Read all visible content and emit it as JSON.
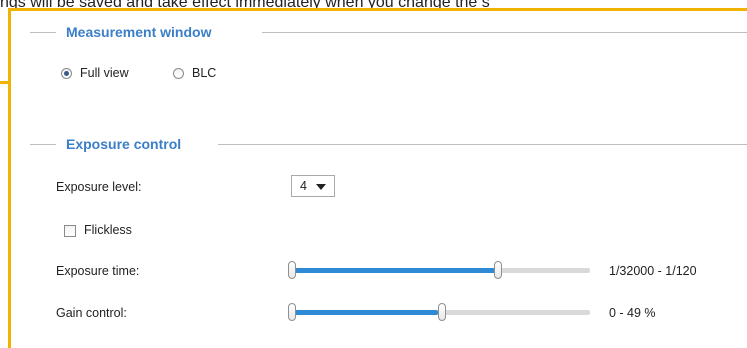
{
  "top_text_fragment": "ngs will be saved and take effect immediately when you change the s",
  "measurement_window": {
    "title": "Measurement window",
    "options": [
      {
        "label": "Full view",
        "selected": true
      },
      {
        "label": "BLC",
        "selected": false
      }
    ]
  },
  "exposure_control": {
    "title": "Exposure control",
    "exposure_level": {
      "label": "Exposure level:",
      "value": "4"
    },
    "flickless": {
      "label": "Flickless",
      "checked": false
    },
    "exposure_time": {
      "label": "Exposure time:",
      "range_text": "1/32000 - 1/120",
      "range_fraction": [
        0.0,
        0.69
      ]
    },
    "gain_control": {
      "label": "Gain control:",
      "range_text": "0 - 49 %",
      "range_fraction": [
        0.0,
        0.49
      ]
    }
  },
  "colors": {
    "accent_blue": "#3a7fc8",
    "slider_fill": "#2f8ad6",
    "panel_border": "#f2b200"
  }
}
